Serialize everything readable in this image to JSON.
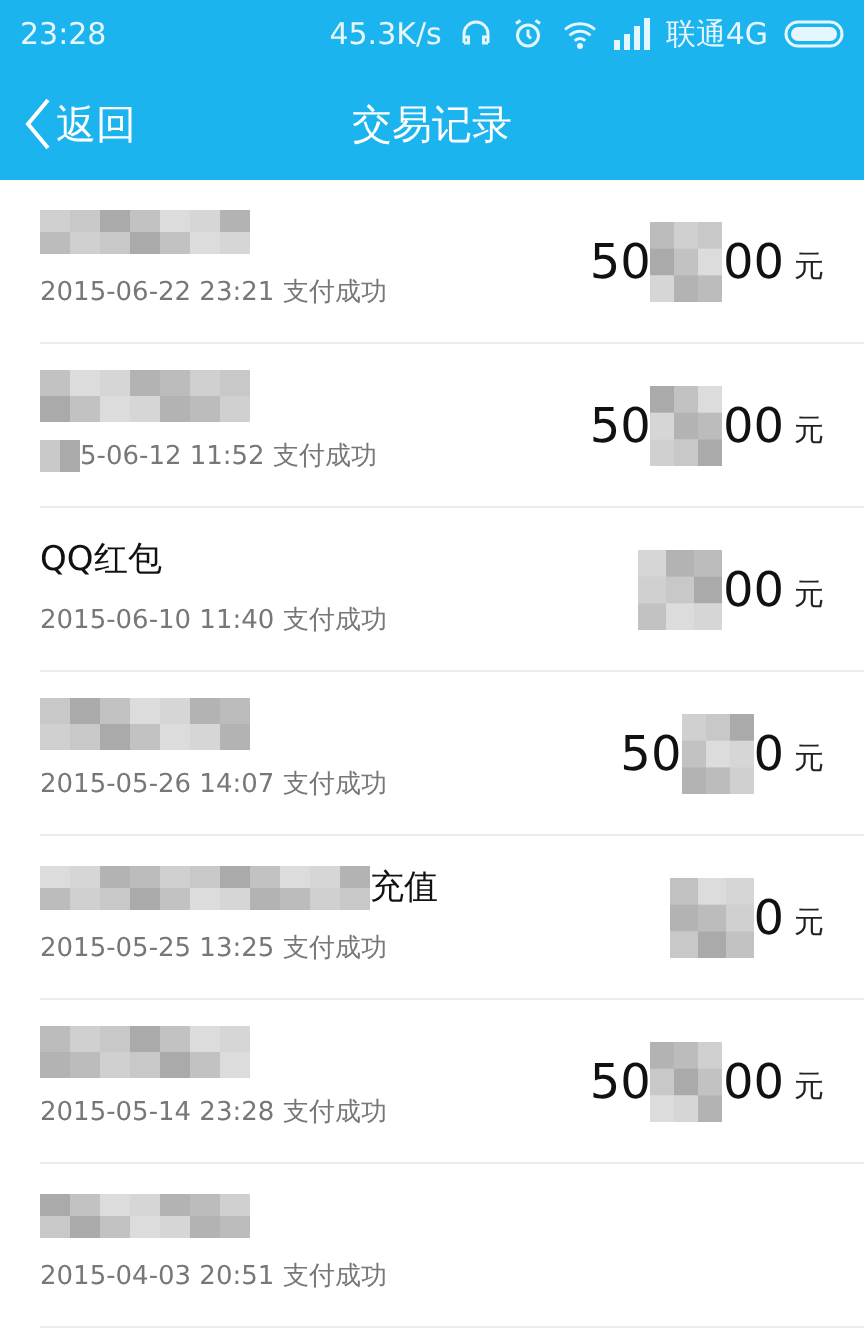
{
  "status_bar": {
    "time": "23:28",
    "speed": "45.3K/s",
    "carrier": "联通4G"
  },
  "nav": {
    "back": "返回",
    "title": "交易记录"
  },
  "records": [
    {
      "title_redacted": true,
      "date": "2015-06-22 23:21 支付成功",
      "date_redacted": false,
      "amount_prefix": "50",
      "amount_redacted": true,
      "amount_suffix": "00",
      "unit": "元"
    },
    {
      "title_redacted": true,
      "date": "5-06-12 11:52 支付成功",
      "date_redacted": true,
      "amount_prefix": "50",
      "amount_redacted": true,
      "amount_suffix": "00",
      "unit": "元"
    },
    {
      "title_redacted": false,
      "title": "QQ红包",
      "date": "2015-06-10 11:40 支付成功",
      "date_redacted": false,
      "amount_redacted": true,
      "amount_suffix": "00",
      "unit": "元"
    },
    {
      "title_redacted": true,
      "date": "2015-05-26 14:07 支付成功",
      "date_redacted": false,
      "amount_prefix": "50",
      "amount_redacted": true,
      "amount_suffix": "0",
      "unit": "元"
    },
    {
      "title_redacted": true,
      "title": "充值",
      "date": "2015-05-25 13:25 支付成功",
      "date_redacted": false,
      "amount_redacted": true,
      "amount_suffix": "0",
      "unit": "元"
    },
    {
      "title_redacted": true,
      "date": "2015-05-14 23:28 支付成功",
      "date_redacted": false,
      "amount_prefix": "50",
      "amount_redacted": true,
      "amount_suffix": "00",
      "unit": "元"
    },
    {
      "title_redacted": true,
      "date": "2015-04-03 20:51 支付成功",
      "date_redacted": false
    }
  ]
}
